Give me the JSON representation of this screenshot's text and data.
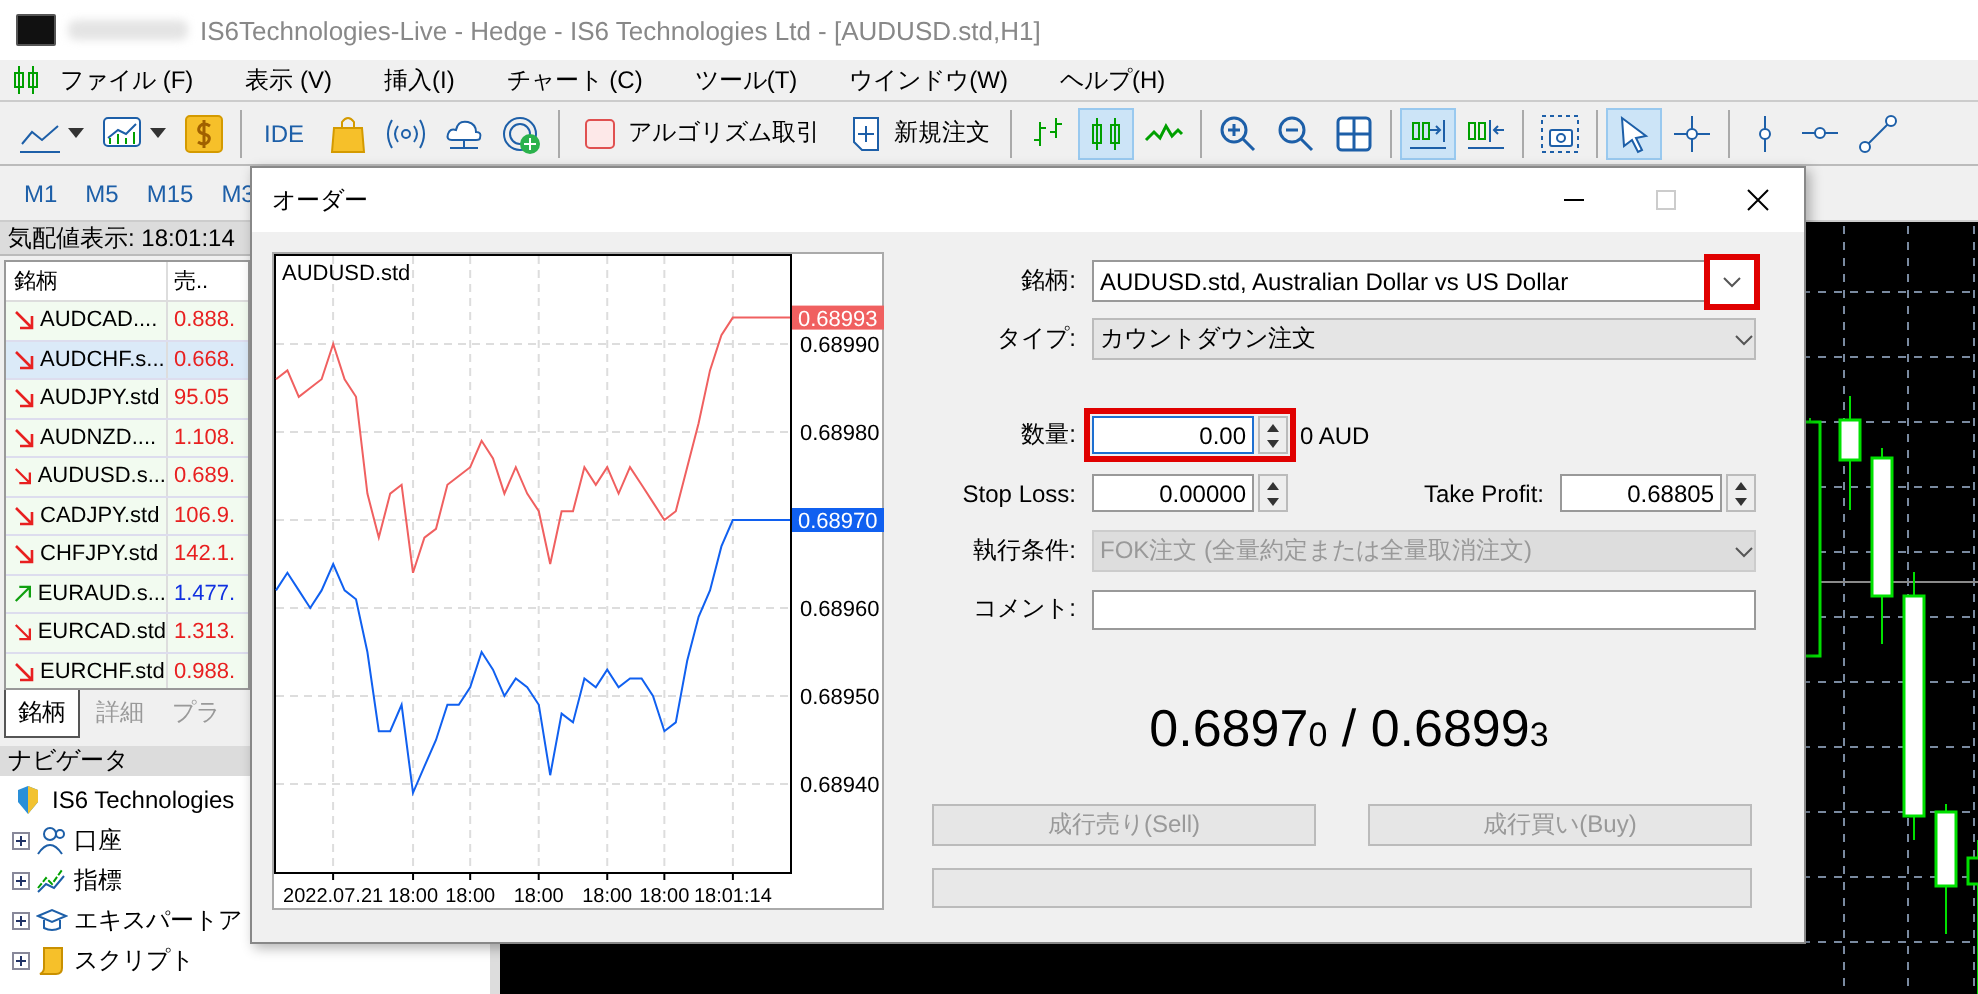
{
  "window": {
    "title": "IS6Technologies-Live - Hedge - IS6 Technologies Ltd - [AUDUSD.std,H1]"
  },
  "menu": [
    "ファイル (F)",
    "表示 (V)",
    "挿入(I)",
    "チャート (C)",
    "ツール(T)",
    "ウインドウ(W)",
    "ヘルプ(H)"
  ],
  "toolbar": [
    {
      "kind": "dropdown",
      "on": false
    },
    {
      "kind": "dropdown",
      "on": false
    },
    {
      "kind": "icon",
      "on": false
    },
    {
      "kind": "separator"
    },
    {
      "kind": "text",
      "label": "IDE",
      "on": false
    },
    {
      "kind": "icon",
      "on": false
    },
    {
      "kind": "icon",
      "on": false
    },
    {
      "kind": "icon",
      "on": false
    },
    {
      "kind": "icon",
      "on": false
    },
    {
      "kind": "separator"
    },
    {
      "kind": "icon-text",
      "label": "アルゴリズム取引",
      "on": false
    },
    {
      "kind": "icon-text",
      "label": "新規注文",
      "on": false
    },
    {
      "kind": "separator"
    },
    {
      "kind": "icon",
      "on": false
    },
    {
      "kind": "icon",
      "on": true
    },
    {
      "kind": "icon",
      "on": false
    },
    {
      "kind": "separator"
    },
    {
      "kind": "icon",
      "on": false
    },
    {
      "kind": "icon",
      "on": false
    },
    {
      "kind": "icon",
      "on": false
    },
    {
      "kind": "separator"
    },
    {
      "kind": "icon",
      "on": true
    },
    {
      "kind": "icon",
      "on": false
    },
    {
      "kind": "separator"
    },
    {
      "kind": "icon",
      "on": false
    },
    {
      "kind": "separator"
    },
    {
      "kind": "icon",
      "on": true
    },
    {
      "kind": "icon",
      "on": false
    },
    {
      "kind": "separator"
    },
    {
      "kind": "icon",
      "on": false
    },
    {
      "kind": "icon",
      "on": false
    },
    {
      "kind": "icon",
      "on": false
    }
  ],
  "timeframes": [
    "M1",
    "M5",
    "M15",
    "M3"
  ],
  "market_watch": {
    "title": "気配値表示: 18:01:14",
    "columns": [
      "銘柄",
      "売.."
    ],
    "rows": [
      {
        "symbol": "AUDCAD....",
        "bid": "0.888.",
        "kind": "down",
        "selected": false
      },
      {
        "symbol": "AUDCHF.s...",
        "bid": "0.668.",
        "kind": "down",
        "selected": true
      },
      {
        "symbol": "AUDJPY.std",
        "bid": "95.05",
        "kind": "down",
        "selected": false
      },
      {
        "symbol": "AUDNZD....",
        "bid": "1.108.",
        "kind": "down",
        "selected": false
      },
      {
        "symbol": "AUDUSD.s...",
        "bid": "0.689.",
        "kind": "down",
        "selected": false
      },
      {
        "symbol": "CADJPY.std",
        "bid": "106.9.",
        "kind": "down",
        "selected": false
      },
      {
        "symbol": "CHFJPY.std",
        "bid": "142.1.",
        "kind": "down",
        "selected": false
      },
      {
        "symbol": "EURAUD.s...",
        "bid": "1.477.",
        "kind": "up",
        "selected": false
      },
      {
        "symbol": "EURCAD.std",
        "bid": "1.313.",
        "kind": "down",
        "selected": false
      },
      {
        "symbol": "EURCHF.std",
        "bid": "0.988.",
        "kind": "down",
        "selected": false
      }
    ],
    "tabs": [
      {
        "label": "銘柄",
        "selected": true
      },
      {
        "label": "詳細",
        "selected": false
      },
      {
        "label": "プラ",
        "selected": false
      }
    ]
  },
  "navigator": {
    "title": "ナビゲータ",
    "root": {
      "label": "IS6 Technologies",
      "children": [
        {
          "label": "口座",
          "expanded": false
        },
        {
          "label": "指標",
          "expanded": false
        },
        {
          "label": "エキスパートア",
          "expanded": false
        },
        {
          "label": "スクリプト",
          "expanded": false
        }
      ]
    }
  },
  "order_dialog": {
    "title": "オーダー",
    "chart": {
      "chart_data": {
        "type": "line",
        "title": "AUDUSD.std",
        "grid": true,
        "categories": [
          null,
          null,
          null,
          null,
          null,
          "2022.07.21",
          null,
          null,
          null,
          null,
          null,
          null,
          "18:00",
          null,
          null,
          null,
          null,
          "18:00",
          null,
          null,
          null,
          null,
          null,
          "18:00",
          null,
          null,
          null,
          null,
          null,
          "18:00",
          null,
          null,
          null,
          null,
          "18:00",
          null,
          null,
          null,
          null,
          null,
          "18:01:14",
          null,
          null,
          null,
          null,
          null
        ],
        "series": [
          {
            "color": "#f06060",
            "values": [
              0.68986,
              0.68987,
              0.68984,
              0.68985,
              0.68986,
              0.6899,
              0.68986,
              0.68984,
              0.68973,
              0.68968,
              0.68973,
              0.68974,
              0.68964,
              0.68968,
              0.68969,
              0.68974,
              0.68975,
              0.68976,
              0.68979,
              0.68977,
              0.68973,
              0.68976,
              0.68973,
              0.68971,
              0.68965,
              0.68971,
              0.68971,
              0.68976,
              0.68974,
              0.68976,
              0.68973,
              0.68976,
              0.68974,
              0.68972,
              0.6897,
              0.68971,
              0.68976,
              0.68981,
              0.68987,
              0.68991,
              0.68993,
              0.68993,
              0.68993,
              0.68993,
              0.68993,
              0.68993
            ]
          },
          {
            "color": "#1060f0",
            "values": [
              0.68962,
              0.68964,
              0.68962,
              0.6896,
              0.68962,
              0.68965,
              0.68962,
              0.68961,
              0.68955,
              0.68946,
              0.68946,
              0.68949,
              0.68939,
              0.68942,
              0.68945,
              0.68949,
              0.68949,
              0.68951,
              0.68955,
              0.68953,
              0.6895,
              0.68952,
              0.68951,
              0.68949,
              0.68941,
              0.68948,
              0.68947,
              0.68952,
              0.68951,
              0.68953,
              0.68951,
              0.68952,
              0.68952,
              0.6895,
              0.68946,
              0.68947,
              0.68954,
              0.68959,
              0.68962,
              0.68967,
              0.6897,
              0.6897,
              0.6897,
              0.6897,
              0.6897,
              0.6897
            ]
          }
        ],
        "ylim": [
          0.6893,
          0.69
        ],
        "yticks": [
          {
            "value": 0.6894,
            "label": "0.68940"
          },
          {
            "value": 0.6895,
            "label": "0.68950"
          },
          {
            "value": 0.6896,
            "label": "0.68960"
          },
          {
            "value": 0.6897,
            "label": "0.68970"
          },
          {
            "value": 0.6898,
            "label": "0.68980"
          },
          {
            "value": 0.6899,
            "label": "0.68990"
          }
        ]
      },
      "price_tags": [
        {
          "label": "0.68993",
          "color": "#f06060"
        },
        {
          "label": "0.68970",
          "color": "#1060f0"
        }
      ]
    },
    "symbol": {
      "label": "銘柄:",
      "value": "AUDUSD.std, Australian Dollar vs US Dollar",
      "highlighted": true
    },
    "type": {
      "label": "タイプ:",
      "value": "カウントダウン注文"
    },
    "volume": {
      "label": "数量:",
      "value": "0.00",
      "unit": "0 AUD",
      "highlighted": true
    },
    "stop_loss": {
      "label": "Stop Loss:",
      "value": "0.00000"
    },
    "take_profit": {
      "label": "Take Profit:",
      "value": "0.68805"
    },
    "fill_policy": {
      "label": "執行条件:",
      "value": "FOK注文 (全量約定または全量取消注文)",
      "disabled": true
    },
    "comment": {
      "label": "コメント:"
    },
    "quote": "0.6897$_{0}$ / 0.6899$_{3}$",
    "buttons": [
      {
        "label": "成行売り(Sell)",
        "disabled": true
      },
      {
        "label": "成行買い(Buy)",
        "disabled": true
      }
    ]
  }
}
